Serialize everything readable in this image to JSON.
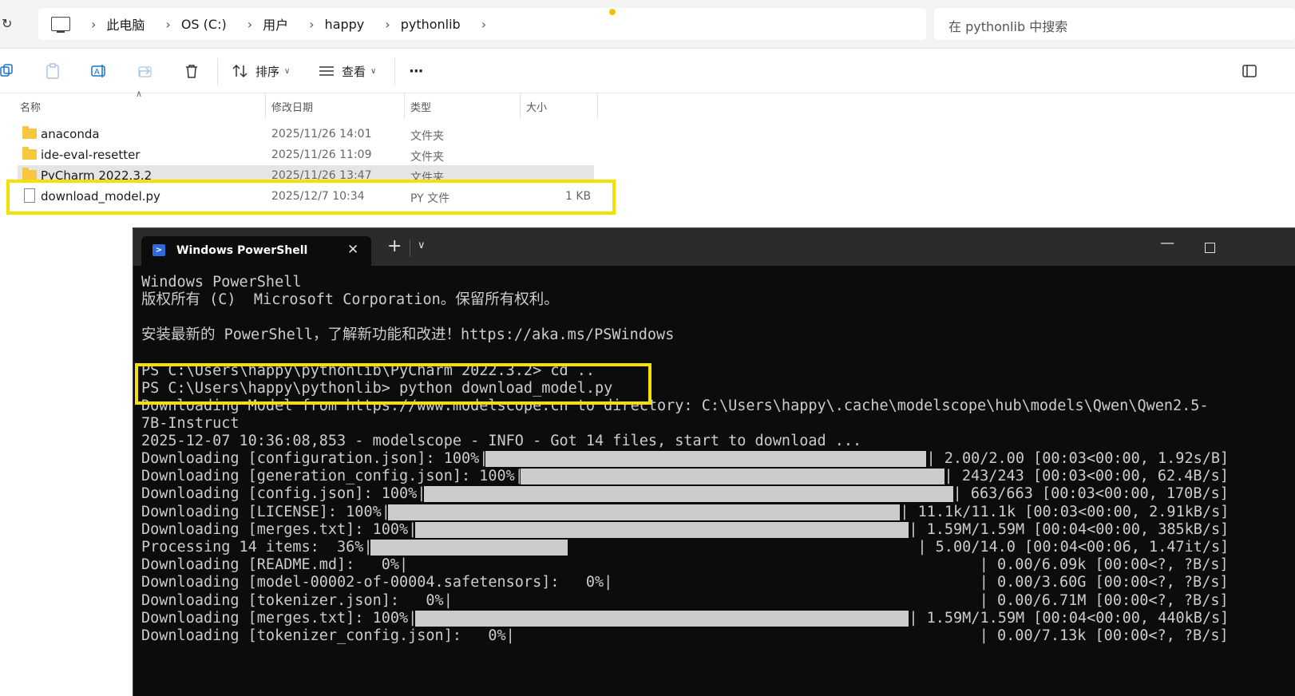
{
  "explorer": {
    "breadcrumbs": [
      "此电脑",
      "OS (C:)",
      "用户",
      "happy",
      "pythonlib"
    ],
    "search_placeholder": "在 pythonlib 中搜索",
    "toolbar": {
      "sort_label": "排序",
      "view_label": "查看",
      "more_label": "···"
    },
    "columns": {
      "name": "名称",
      "modified": "修改日期",
      "type": "类型",
      "size": "大小"
    },
    "files": [
      {
        "name": "anaconda",
        "modified": "2025/11/26 14:01",
        "type": "文件夹",
        "size": "",
        "kind": "folder"
      },
      {
        "name": "ide-eval-resetter",
        "modified": "2025/11/26 11:09",
        "type": "文件夹",
        "size": "",
        "kind": "folder"
      },
      {
        "name": "PyCharm 2022.3.2",
        "modified": "2025/11/26 13:47",
        "type": "文件夹",
        "size": "",
        "kind": "folder"
      },
      {
        "name": "download_model.py",
        "modified": "2025/12/7 10:34",
        "type": "PY 文件",
        "size": "1 KB",
        "kind": "file"
      }
    ]
  },
  "terminal": {
    "tab_title": "Windows PowerShell",
    "lines": [
      "Windows PowerShell",
      "版权所有 (C)  Microsoft Corporation。保留所有权利。",
      "",
      "安装最新的 PowerShell，了解新功能和改进！https://aka.ms/PSWindows",
      "",
      "PS C:\\Users\\happy\\pythonlib\\PyCharm 2022.3.2> cd ..",
      "PS C:\\Users\\happy\\pythonlib> python download_model.py",
      "Downloading Model from https://www.modelscope.cn to directory: C:\\Users\\happy\\.cache\\modelscope\\hub\\models\\Qwen\\Qwen2.5-",
      "7B-Instruct",
      "2025-12-07 10:36:08,853 - modelscope - INFO - Got 14 files, start to download ..."
    ],
    "progress": [
      {
        "prefix": "Downloading [configuration.json]: 100%|",
        "suffix": "| 2.00/2.00 [00:03<00:00, 1.92s/B]",
        "fraction": 1.0
      },
      {
        "prefix": "Downloading [generation_config.json]: 100%|",
        "suffix": "| 243/243 [00:03<00:00, 62.4B/s]",
        "fraction": 1.0
      },
      {
        "prefix": "Downloading [config.json]: 100%|",
        "suffix": "| 663/663 [00:03<00:00, 170B/s]",
        "fraction": 1.0
      },
      {
        "prefix": "Downloading [LICENSE]: 100%|",
        "suffix": "| 11.1k/11.1k [00:03<00:00, 2.91kB/s]",
        "fraction": 1.0
      },
      {
        "prefix": "Downloading [merges.txt]: 100%|",
        "suffix": "| 1.59M/1.59M [00:04<00:00, 385kB/s]",
        "fraction": 1.0
      },
      {
        "prefix": "Processing 14 items:  36%|",
        "suffix": "| 5.00/14.0 [00:04<00:06, 1.47it/s]",
        "fraction": 0.36
      },
      {
        "prefix": "Downloading [README.md]:   0%|",
        "suffix": "| 0.00/6.09k [00:00<?, ?B/s]",
        "fraction": 0
      },
      {
        "prefix": "Downloading [model-00002-of-00004.safetensors]:   0%|",
        "suffix": "| 0.00/3.60G [00:00<?, ?B/s]",
        "fraction": 0
      },
      {
        "prefix": "Downloading [tokenizer.json]:   0%|",
        "suffix": "| 0.00/6.71M [00:00<?, ?B/s]",
        "fraction": 0
      },
      {
        "prefix": "Downloading [merges.txt]: 100%|",
        "suffix": "| 1.59M/1.59M [00:04<00:00, 440kB/s]",
        "fraction": 1.0
      },
      {
        "prefix": "Downloading [tokenizer_config.json]:   0%|",
        "suffix": "| 0.00/7.13k [00:00<?, ?B/s]",
        "fraction": 0
      }
    ]
  },
  "colors": {
    "highlight": "#f5e100",
    "terminal_bg": "#0c0c0c",
    "terminal_fg": "#cccccc",
    "folder": "#f8c73e"
  }
}
